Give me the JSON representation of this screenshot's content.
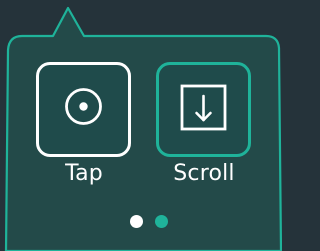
{
  "gestures": [
    {
      "label": "Tap",
      "icon": "tap-icon",
      "selected": false
    },
    {
      "label": "Scroll",
      "icon": "scroll-down-icon",
      "selected": true
    }
  ],
  "pagination": {
    "page_count": 2,
    "current_page": 1
  },
  "colors": {
    "background": "#25333a",
    "popover_fill": "#234a49",
    "accent": "#1fb39a",
    "foreground": "#ffffff"
  }
}
